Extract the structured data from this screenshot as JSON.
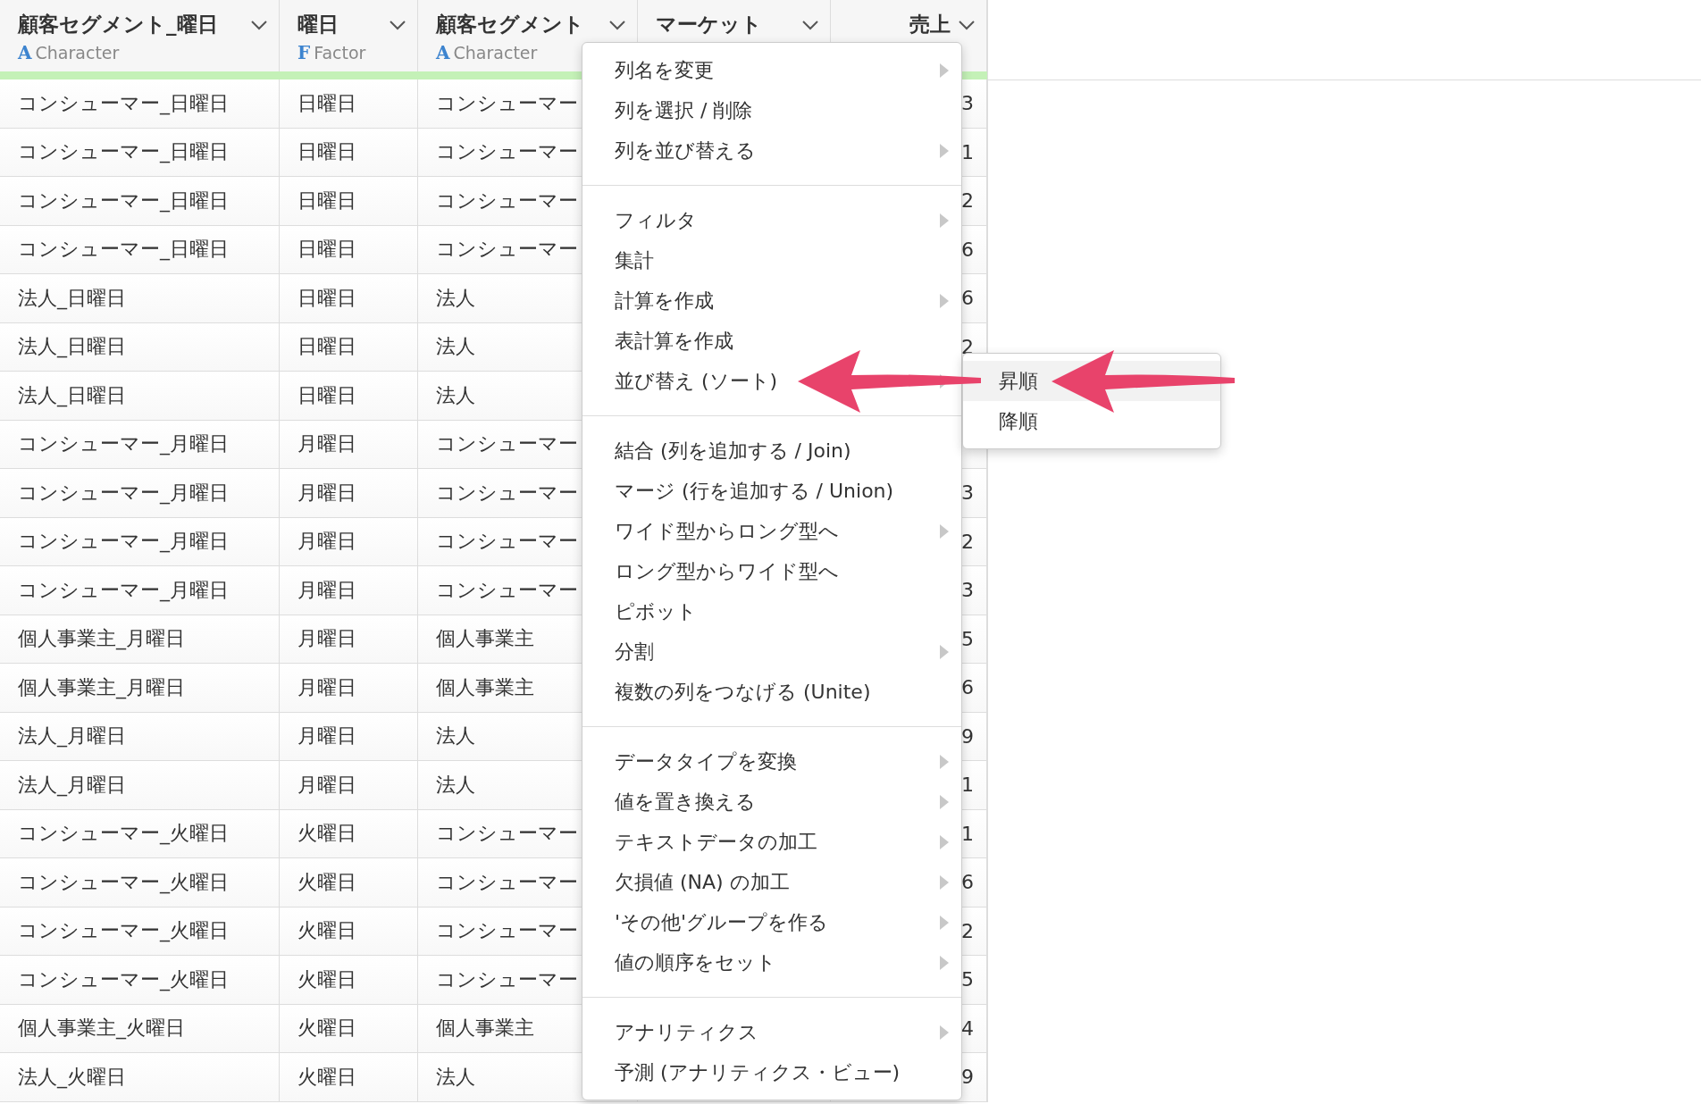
{
  "table": {
    "columns": [
      {
        "title": "顧客セグメント_曜日",
        "kind": "text",
        "type_icon": "A",
        "type": "Character"
      },
      {
        "title": "曜日",
        "kind": "text",
        "type_icon": "F",
        "type": "Factor"
      },
      {
        "title": "顧客セグメント",
        "kind": "text",
        "type_icon": "A",
        "type": "Character"
      },
      {
        "title": "マーケット",
        "kind": "text"
      },
      {
        "title": "売上",
        "kind": "number"
      }
    ],
    "rows": [
      {
        "segment_day": "コンシューマー_日曜日",
        "day": "日曜日",
        "segment": "コンシューマー",
        "sales": "3"
      },
      {
        "segment_day": "コンシューマー_日曜日",
        "day": "日曜日",
        "segment": "コンシューマー",
        "sales": "1"
      },
      {
        "segment_day": "コンシューマー_日曜日",
        "day": "日曜日",
        "segment": "コンシューマー",
        "sales": "2"
      },
      {
        "segment_day": "コンシューマー_日曜日",
        "day": "日曜日",
        "segment": "コンシューマー",
        "sales": "6"
      },
      {
        "segment_day": "法人_日曜日",
        "day": "日曜日",
        "segment": "法人",
        "sales": "6"
      },
      {
        "segment_day": "法人_日曜日",
        "day": "日曜日",
        "segment": "法人",
        "sales": "2"
      },
      {
        "segment_day": "法人_日曜日",
        "day": "日曜日",
        "segment": "法人"
      },
      {
        "segment_day": "コンシューマー_月曜日",
        "day": "月曜日",
        "segment": "コンシューマー"
      },
      {
        "segment_day": "コンシューマー_月曜日",
        "day": "月曜日",
        "segment": "コンシューマー",
        "sales": "3"
      },
      {
        "segment_day": "コンシューマー_月曜日",
        "day": "月曜日",
        "segment": "コンシューマー",
        "sales": "2"
      },
      {
        "segment_day": "コンシューマー_月曜日",
        "day": "月曜日",
        "segment": "コンシューマー",
        "sales": "3"
      },
      {
        "segment_day": "個人事業主_月曜日",
        "day": "月曜日",
        "segment": "個人事業主",
        "sales": "5"
      },
      {
        "segment_day": "個人事業主_月曜日",
        "day": "月曜日",
        "segment": "個人事業主",
        "sales": "6"
      },
      {
        "segment_day": "法人_月曜日",
        "day": "月曜日",
        "segment": "法人",
        "sales": "9"
      },
      {
        "segment_day": "法人_月曜日",
        "day": "月曜日",
        "segment": "法人",
        "sales": "1"
      },
      {
        "segment_day": "コンシューマー_火曜日",
        "day": "火曜日",
        "segment": "コンシューマー",
        "sales": "1"
      },
      {
        "segment_day": "コンシューマー_火曜日",
        "day": "火曜日",
        "segment": "コンシューマー",
        "sales": "6"
      },
      {
        "segment_day": "コンシューマー_火曜日",
        "day": "火曜日",
        "segment": "コンシューマー",
        "sales": "2"
      },
      {
        "segment_day": "コンシューマー_火曜日",
        "day": "火曜日",
        "segment": "コンシューマー",
        "sales": "5"
      },
      {
        "segment_day": "個人事業主_火曜日",
        "day": "火曜日",
        "segment": "個人事業主",
        "sales": "4"
      },
      {
        "segment_day": "法人_火曜日",
        "day": "火曜日",
        "segment": "法人",
        "sales": "9"
      }
    ]
  },
  "context_menu": {
    "groups": [
      {
        "items": [
          {
            "label": "列名を変更",
            "submenu": true
          },
          {
            "label": "列を選択 / 削除",
            "submenu": false
          },
          {
            "label": "列を並び替える",
            "submenu": true
          }
        ]
      },
      {
        "items": [
          {
            "label": "フィルタ",
            "submenu": true
          },
          {
            "label": "集計",
            "submenu": false
          },
          {
            "label": "計算を作成",
            "submenu": true
          },
          {
            "label": "表計算を作成",
            "submenu": false
          },
          {
            "label": "並び替え (ソート)",
            "submenu": true
          }
        ]
      },
      {
        "items": [
          {
            "label": "結合 (列を追加する / Join)",
            "submenu": false
          },
          {
            "label": "マージ (行を追加する / Union)",
            "submenu": false
          },
          {
            "label": "ワイド型からロング型へ",
            "submenu": true
          },
          {
            "label": "ロング型からワイド型へ",
            "submenu": false
          },
          {
            "label": "ピボット",
            "submenu": false
          },
          {
            "label": "分割",
            "submenu": true
          },
          {
            "label": "複数の列をつなげる (Unite)",
            "submenu": false
          }
        ]
      },
      {
        "items": [
          {
            "label": "データタイプを変換",
            "submenu": true
          },
          {
            "label": "値を置き換える",
            "submenu": true
          },
          {
            "label": "テキストデータの加工",
            "submenu": true
          },
          {
            "label": "欠損値 (NA) の加工",
            "submenu": true
          },
          {
            "label": "'その他'グループを作る",
            "submenu": true
          },
          {
            "label": "値の順序をセット",
            "submenu": true
          }
        ]
      },
      {
        "items": [
          {
            "label": "アナリティクス",
            "submenu": true
          },
          {
            "label": "予測 (アナリティクス・ビュー)",
            "submenu": false
          }
        ]
      }
    ]
  },
  "submenu": {
    "items": [
      {
        "label": "昇順",
        "selected": true
      },
      {
        "label": "降順",
        "selected": false
      }
    ]
  }
}
